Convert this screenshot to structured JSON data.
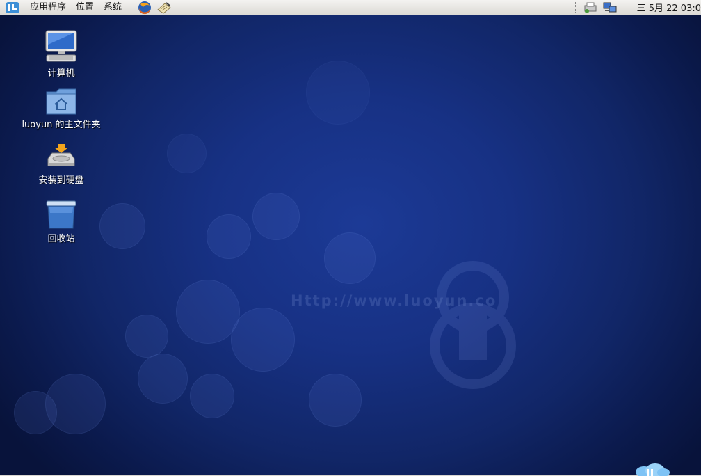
{
  "panel": {
    "menus": [
      "应用程序",
      "位置",
      "系统"
    ],
    "launchers": [
      "firefox-icon",
      "notes-icon"
    ],
    "tray": [
      "network-printer-icon",
      "network-computer-icon"
    ],
    "clock": "三 5月 22 03:0"
  },
  "desktop": {
    "icons": [
      {
        "name": "computer-icon",
        "label": "计算机"
      },
      {
        "name": "home-folder-icon",
        "label": "luoyun 的主文件夹"
      },
      {
        "name": "install-disk-icon",
        "label": "安装到硬盘"
      },
      {
        "name": "trash-icon",
        "label": "回收站"
      }
    ],
    "watermark": "Http://www.luoyun.co"
  },
  "colors": {
    "panel_bg": "#dcdad5",
    "desktop_center": "#1c3a96",
    "desktop_edge": "#08133b"
  }
}
